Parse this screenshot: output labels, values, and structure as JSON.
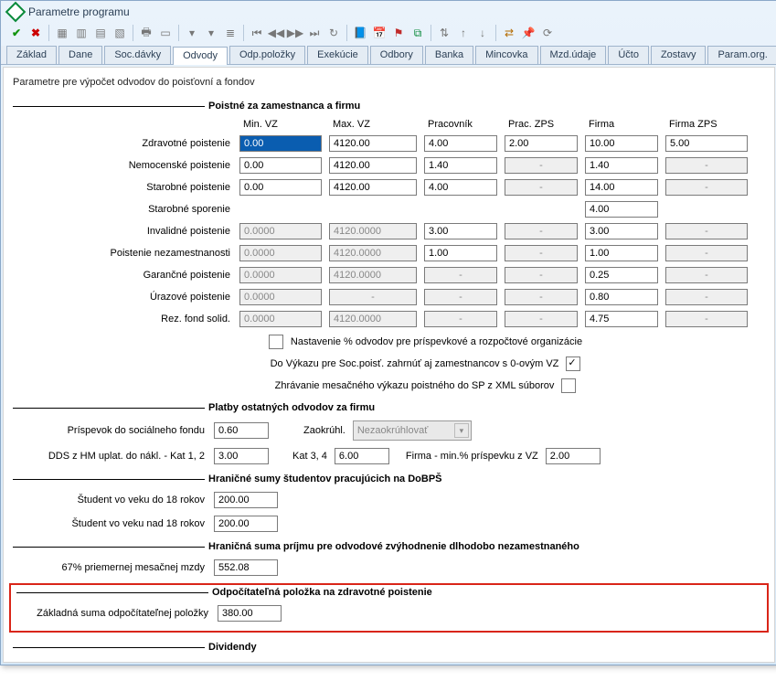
{
  "title": "Parametre programu",
  "tabs": [
    "Základ",
    "Dane",
    "Soc.dávky",
    "Odvody",
    "Odp.položky",
    "Exekúcie",
    "Odbory",
    "Banka",
    "Mincovka",
    "Mzd.údaje",
    "Účto",
    "Zostavy",
    "Param.org."
  ],
  "active_tab": "Odvody",
  "panel_head": "Parametre pre výpočet odvodov do poisťovní a fondov",
  "sec1_title": "Poistné za zamestnanca a firmu",
  "hdr": {
    "min": "Min. VZ",
    "max": "Max. VZ",
    "prac": "Pracovník",
    "zps": "Prac. ZPS",
    "firma": "Firma",
    "fzp": "Firma ZPS"
  },
  "rows": {
    "zdrav": {
      "lbl": "Zdravotné poistenie",
      "min": "0.00",
      "max": "4120.00",
      "prac": "4.00",
      "zps": "2.00",
      "firma": "10.00",
      "fzp": "5.00"
    },
    "nemoc": {
      "lbl": "Nemocenské poistenie",
      "min": "0.00",
      "max": "4120.00",
      "prac": "1.40",
      "zps": "-",
      "firma": "1.40",
      "fzp": "-"
    },
    "star": {
      "lbl": "Starobné poistenie",
      "min": "0.00",
      "max": "4120.00",
      "prac": "4.00",
      "zps": "-",
      "firma": "14.00",
      "fzp": "-"
    },
    "sspor": {
      "lbl": "Starobné sporenie",
      "firma": "4.00"
    },
    "inval": {
      "lbl": "Invalidné poistenie",
      "min": "0.0000",
      "max": "4120.0000",
      "prac": "3.00",
      "zps": "-",
      "firma": "3.00",
      "fzp": "-"
    },
    "nezam": {
      "lbl": "Poistenie  nezamestnanosti",
      "min": "0.0000",
      "max": "4120.0000",
      "prac": "1.00",
      "zps": "-",
      "firma": "1.00",
      "fzp": "-"
    },
    "garan": {
      "lbl": "Garančné poistenie",
      "min": "0.0000",
      "max": "4120.0000",
      "prac": "-",
      "zps": "-",
      "firma": "0.25",
      "fzp": "-"
    },
    "uraz": {
      "lbl": "Úrazové poistenie",
      "min": "0.0000",
      "max": "-",
      "prac": "-",
      "zps": "-",
      "firma": "0.80",
      "fzp": "-"
    },
    "rez": {
      "lbl": "Rez. fond solid.",
      "min": "0.0000",
      "max": "4120.0000",
      "prac": "-",
      "zps": "-",
      "firma": "4.75",
      "fzp": "-"
    }
  },
  "opt1": "Nastavenie % odvodov pre príspevkové a rozpočtové organizácie",
  "opt2": "Do Výkazu pre Soc.poisť. zahrnúť aj zamestnancov s 0-ovým VZ",
  "opt3": "Zhrávanie mesačného výkazu poistného do SP z XML súborov",
  "opt2_checked": true,
  "sec2_title": "Platby ostatných odvodov za firmu",
  "sf_lbl": "Príspevok do sociálneho fondu",
  "sf_val": "0.60",
  "zaokr_lbl": "Zaokrúhl.",
  "zaokr_val": "Nezaokrúhlovať",
  "dds_lbl": "DDS z HM uplat. do nákl. - Kat 1, 2",
  "dds12_val": "3.00",
  "dds34_lbl": "Kat 3, 4",
  "dds34_val": "6.00",
  "dds_firma_lbl": "Firma - min.% príspevku z VZ",
  "dds_firma_val": "2.00",
  "sec3_title": "Hraničné sumy študentov pracujúcich na DoBPŠ",
  "stud18a_lbl": "Študent vo veku do 18 rokov",
  "stud18a_val": "200.00",
  "stud18b_lbl": "Študent vo veku nad 18 rokov",
  "stud18b_val": "200.00",
  "sec4_title": "Hraničná suma príjmu pre odvodové zvýhodnenie dlhodobo nezamestnaného",
  "avg_lbl": "67% priemernej mesačnej mzdy",
  "avg_val": "552.08",
  "sec5_title": "Odpočítateľná položka na zdravotné poistenie",
  "odp_lbl": "Základná suma odpočítateľnej položky",
  "odp_val": "380.00",
  "sec6_title": "Dividendy"
}
